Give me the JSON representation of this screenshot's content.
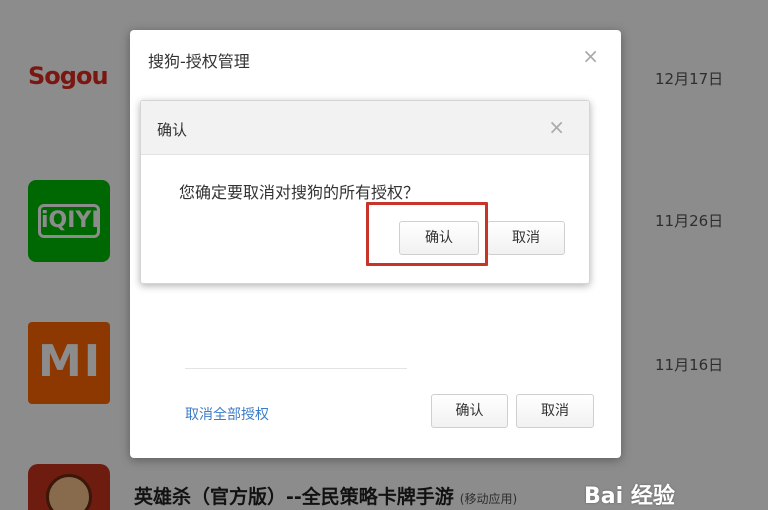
{
  "background": {
    "sogou_logo_text": "Sogou",
    "iqiyi_logo_text": "iQIYI",
    "mi_logo_text": "MI",
    "dates": [
      "12月17日",
      "11月26日",
      "11月16日"
    ],
    "game_name": "英雄杀（官方版）--全民策略卡牌手游",
    "game_tag": "(移动应用)",
    "watermark": "Bai 经验"
  },
  "outer_dialog": {
    "title": "搜狗-授权管理",
    "close_icon": "×",
    "revoke_all_link": "取消全部授权",
    "confirm_label": "确认",
    "cancel_label": "取消"
  },
  "confirm_dialog": {
    "title": "确认",
    "close_icon": "×",
    "message": "您确定要取消对搜狗的所有授权？",
    "confirm_label": "确认",
    "cancel_label": "取消"
  },
  "colors": {
    "overlay": "rgba(0,0,0,0.45)",
    "link": "#3d7cc9",
    "highlight": "#c8342a",
    "iqiyi_green": "#00be06",
    "mi_orange": "#ff6700"
  }
}
